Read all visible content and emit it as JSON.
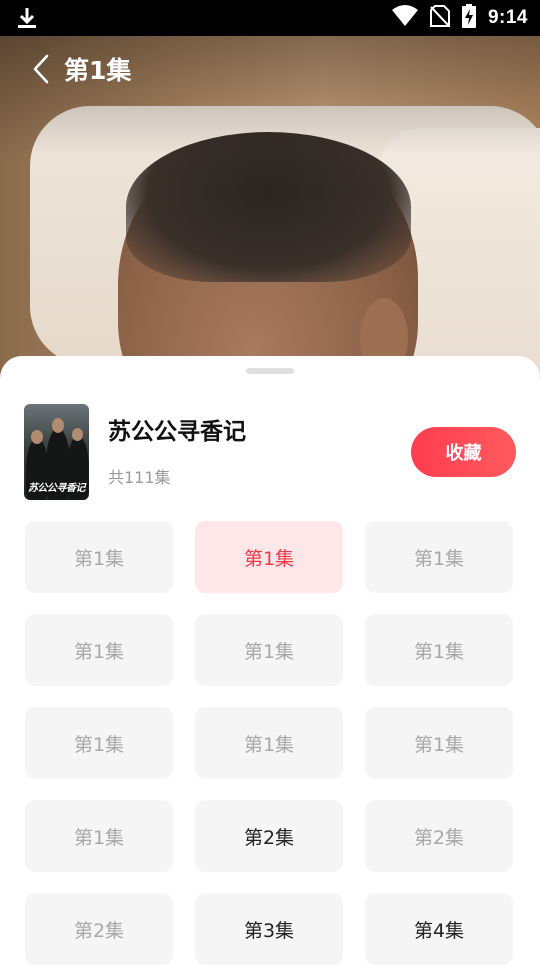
{
  "status_bar": {
    "time": "9:14",
    "icons": [
      "download-icon",
      "wifi-icon",
      "no-sim-icon",
      "battery-charging-icon"
    ]
  },
  "player": {
    "back_icon": "chevron-left-icon",
    "episode_title": "第1集"
  },
  "sheet": {
    "drama_title": "苏公公寻香记",
    "poster_text": "苏公公寻香记",
    "episode_count": "共111集",
    "favorite_label": "收藏",
    "accent_color": "#ff4455",
    "episodes": [
      {
        "label": "第1集",
        "state": "normal"
      },
      {
        "label": "第1集",
        "state": "active"
      },
      {
        "label": "第1集",
        "state": "normal"
      },
      {
        "label": "第1集",
        "state": "normal"
      },
      {
        "label": "第1集",
        "state": "normal"
      },
      {
        "label": "第1集",
        "state": "normal"
      },
      {
        "label": "第1集",
        "state": "normal"
      },
      {
        "label": "第1集",
        "state": "normal"
      },
      {
        "label": "第1集",
        "state": "normal"
      },
      {
        "label": "第1集",
        "state": "normal"
      },
      {
        "label": "第2集",
        "state": "bright"
      },
      {
        "label": "第2集",
        "state": "normal"
      },
      {
        "label": "第2集",
        "state": "normal"
      },
      {
        "label": "第3集",
        "state": "bright"
      },
      {
        "label": "第4集",
        "state": "bright"
      }
    ]
  }
}
